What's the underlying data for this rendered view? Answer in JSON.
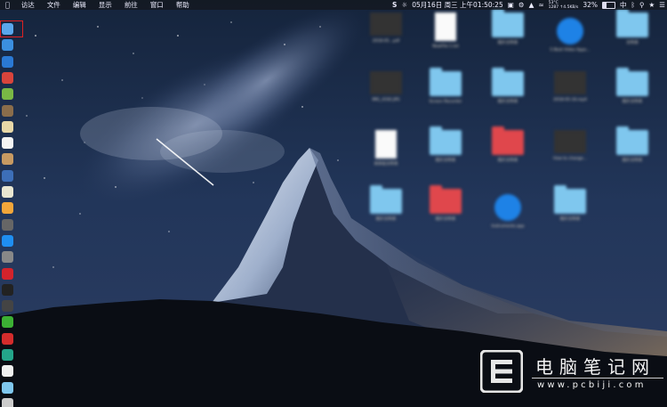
{
  "menubar": {
    "apple_icon": "apple-icon",
    "menus": [
      "访达",
      "文件",
      "编辑",
      "显示",
      "前往",
      "窗口",
      "帮助"
    ],
    "status": {
      "skype": "S",
      "datetime": "05月16日 周三 上午01:50:25",
      "temperature": "53°C",
      "net_up": "1287 ↑4.5KB/s",
      "net_top": "FS/28/s",
      "battery": "32%",
      "battery_level": 0.32,
      "input_method": "中"
    }
  },
  "dock": {
    "items": [
      {
        "name": "finder-icon",
        "color": "#5aa7ec"
      },
      {
        "name": "safari-icon",
        "color": "#3b8fe0"
      },
      {
        "name": "download-icon",
        "color": "#2a79d4"
      },
      {
        "name": "app-red-icon",
        "color": "#d8443c"
      },
      {
        "name": "android-icon",
        "color": "#79b845"
      },
      {
        "name": "book-icon",
        "color": "#8a6d4b"
      },
      {
        "name": "mail-icon",
        "color": "#e8d8a8"
      },
      {
        "name": "calendar-icon",
        "color": "#f4f4f4"
      },
      {
        "name": "contacts-icon",
        "color": "#c79a62"
      },
      {
        "name": "doc-viewer-icon",
        "color": "#3d6fb8"
      },
      {
        "name": "notes-icon",
        "color": "#e9e7d2"
      },
      {
        "name": "photos-icon",
        "color": "#f2a63a"
      },
      {
        "name": "system-icon",
        "color": "#666666"
      },
      {
        "name": "app-store-icon",
        "color": "#1f8ef1"
      },
      {
        "name": "settings-icon",
        "color": "#888888"
      },
      {
        "name": "vivaldi-icon",
        "color": "#d3232b"
      },
      {
        "name": "terminal-icon",
        "color": "#222222"
      },
      {
        "name": "console-icon",
        "color": "#444444"
      },
      {
        "name": "wechat-icon",
        "color": "#3cb034"
      },
      {
        "name": "netease-music-icon",
        "color": "#d32c2c"
      },
      {
        "name": "sync-icon",
        "color": "#24a58a"
      },
      {
        "name": "document-icon",
        "color": "#f0f0f0"
      },
      {
        "name": "folder-icon",
        "color": "#7fc7ee"
      },
      {
        "name": "trash-icon",
        "color": "#cccccc"
      }
    ]
  },
  "desktop_items": [
    {
      "label": "2018-05...pdf",
      "type": "thumb"
    },
    {
      "label": "NewFile-1.txt",
      "type": "doc"
    },
    {
      "label": "照片文件夹",
      "type": "folder"
    },
    {
      "label": "5 Best Video Apps...",
      "type": "app"
    },
    {
      "label": "文件夹",
      "type": "folder"
    },
    {
      "label": "IMG_4192.JPG",
      "type": "thumb"
    },
    {
      "label": "Screen Recorder",
      "type": "folder"
    },
    {
      "label": "照片文件夹",
      "type": "folder"
    },
    {
      "label": "2018-05-16.mp4",
      "type": "thumb"
    },
    {
      "label": "照片文件夹",
      "type": "folder"
    },
    {
      "label": "未命名文件夹",
      "type": "doc"
    },
    {
      "label": "照片文件夹",
      "type": "folder"
    },
    {
      "label": "照片文件夹",
      "type": "folder"
    },
    {
      "label": "How to change...",
      "type": "thumb"
    },
    {
      "label": "照片文件夹",
      "type": "folder"
    },
    {
      "label": "照片文件夹",
      "type": "folder"
    },
    {
      "label": "照片文件夹",
      "type": "folder"
    },
    {
      "label": "Instruments.app",
      "type": "app"
    },
    {
      "label": "照片文件夹",
      "type": "folder"
    }
  ],
  "watermark": {
    "title": "电脑笔记网",
    "url": "www.pcbiji.com",
    "logo": "pcbiji-logo"
  }
}
